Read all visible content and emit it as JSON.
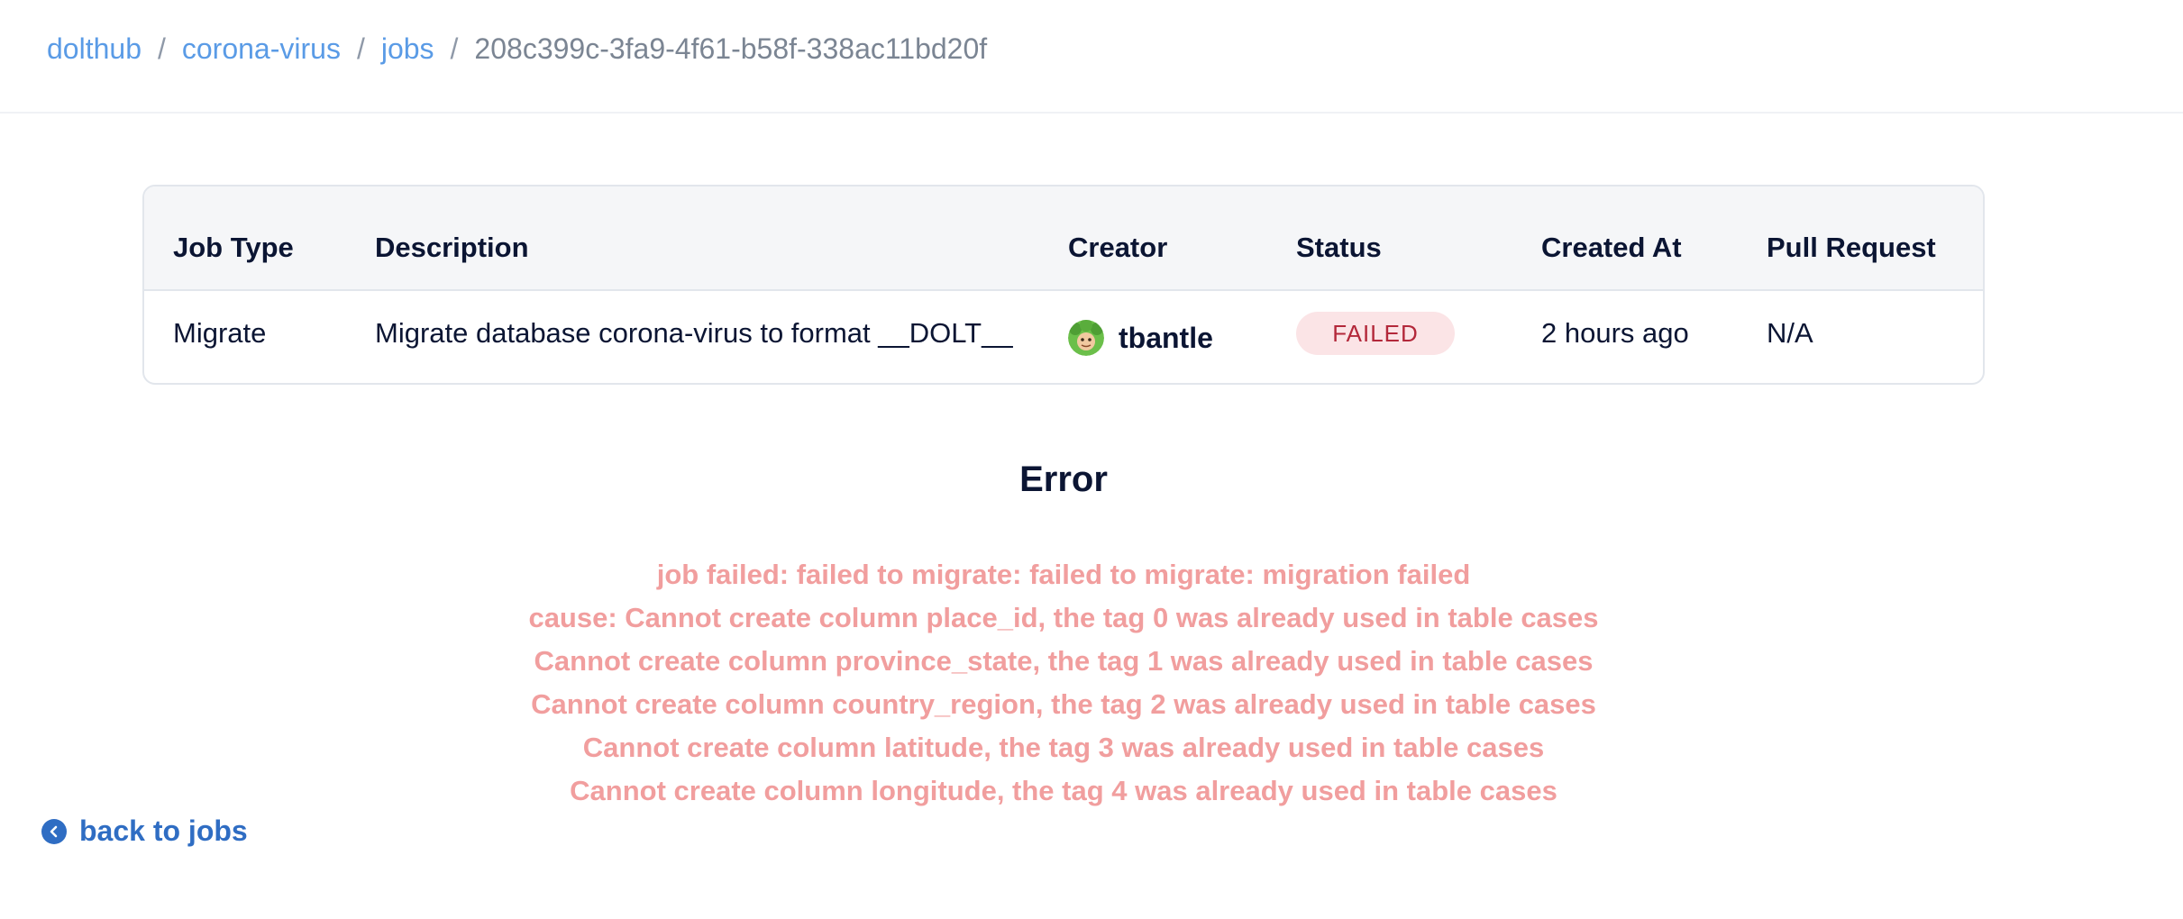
{
  "breadcrumb": {
    "owner": "dolthub",
    "repo": "corona-virus",
    "section": "jobs",
    "job_id": "208c399c-3fa9-4f61-b58f-338ac11bd20f",
    "separator": "/"
  },
  "table": {
    "headers": {
      "job_type": "Job Type",
      "description": "Description",
      "creator": "Creator",
      "status": "Status",
      "created_at": "Created At",
      "pull_request": "Pull Request"
    },
    "row": {
      "job_type": "Migrate",
      "description": "Migrate database corona-virus to format __DOLT__",
      "creator": "tbantle",
      "creator_avatar_icon": "user-avatar-icon",
      "status": "FAILED",
      "created_at": "2 hours ago",
      "pull_request": "N/A"
    }
  },
  "error": {
    "title": "Error",
    "lines": [
      "job failed: failed to migrate: failed to migrate: migration failed",
      "cause: Cannot create column place_id, the tag 0 was already used in table cases",
      "Cannot create column province_state, the tag 1 was already used in table cases",
      "Cannot create column country_region, the tag 2 was already used in table cases",
      "Cannot create column latitude, the tag 3 was already used in table cases",
      "Cannot create column longitude, the tag 4 was already used in table cases"
    ]
  },
  "back_link": {
    "label": "back to jobs",
    "icon": "chevron-left-circle-icon"
  },
  "colors": {
    "link": "#5a9be6",
    "back_link": "#2f6dc3",
    "error_text": "#f19e9e",
    "failed_badge_bg": "#fbe4e6",
    "failed_badge_text": "#b3283a",
    "text_dark": "#0b1533"
  }
}
